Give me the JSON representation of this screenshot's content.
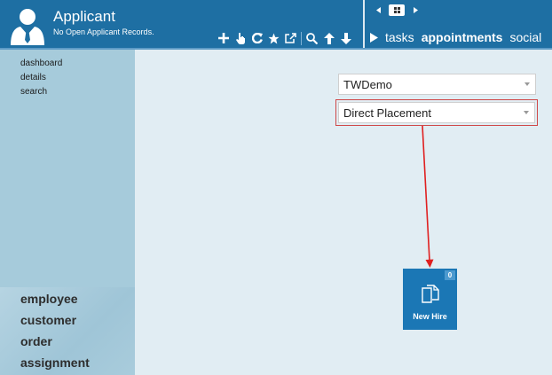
{
  "header": {
    "title": "Applicant",
    "subtitle": "No Open Applicant Records.",
    "avatar_icon": "user-silhouette-icon",
    "toolbar": [
      {
        "icon": "plus-icon",
        "name": "add-button"
      },
      {
        "icon": "pointer-icon",
        "name": "select-button"
      },
      {
        "icon": "refresh-icon",
        "name": "refresh-button"
      },
      {
        "icon": "star-icon",
        "name": "favorite-button"
      },
      {
        "icon": "external-link-icon",
        "name": "open-external-button"
      },
      {
        "icon": "search-icon",
        "name": "search-button"
      },
      {
        "icon": "arrow-up-icon",
        "name": "move-up-button"
      },
      {
        "icon": "arrow-down-icon",
        "name": "move-down-button"
      }
    ],
    "nav": [
      {
        "label": "tasks",
        "active": false
      },
      {
        "label": "appointments",
        "active": true
      },
      {
        "label": "social",
        "active": false
      }
    ]
  },
  "sidebar": {
    "links": [
      "dashboard",
      "details",
      "search"
    ],
    "sections": [
      "employee",
      "customer",
      "order",
      "assignment"
    ]
  },
  "main": {
    "company_select": {
      "value": "TWDemo"
    },
    "type_select": {
      "value": "Direct Placement"
    },
    "tile": {
      "label": "New Hire",
      "count": "0",
      "icon": "documents-icon"
    }
  },
  "colors": {
    "header_bg": "#1e6fa3",
    "sidebar_bg": "#a6cbdb",
    "content_bg": "#e1edf3",
    "tile_bg": "#1b77b5",
    "annotation_red": "#e02020"
  }
}
